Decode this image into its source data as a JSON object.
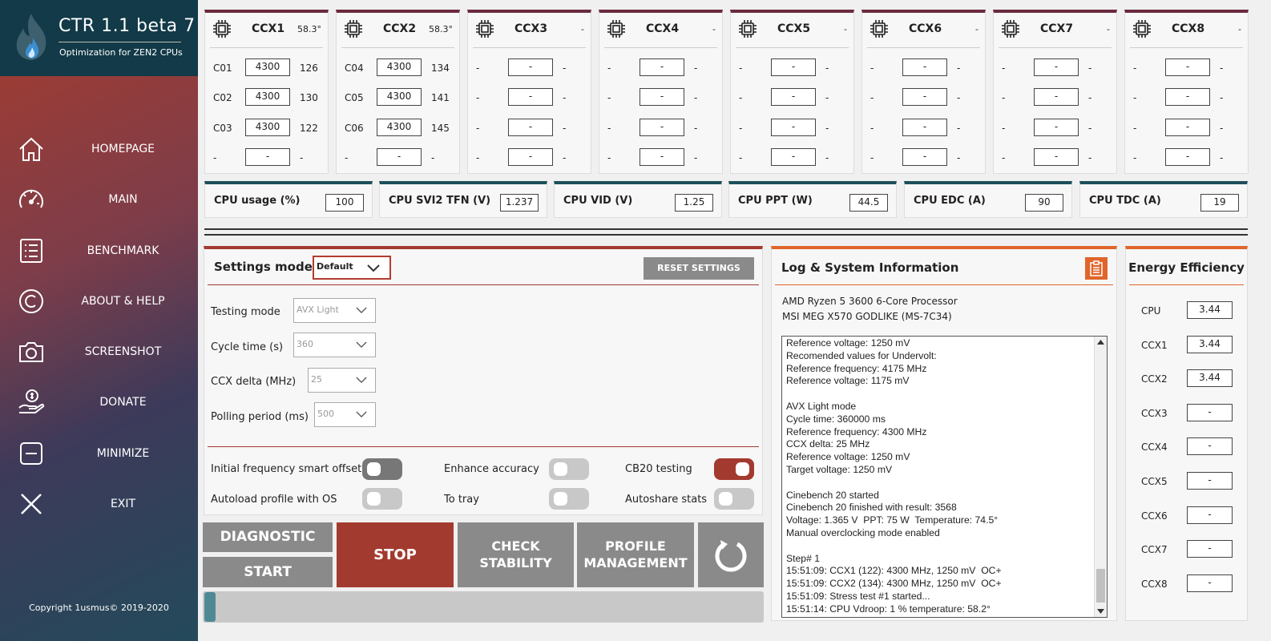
{
  "app": {
    "title": "CTR 1.1 beta 7",
    "subtitle": "Optimization for ZEN2 CPUs",
    "copyright": "Copyright 1usmus© 2019-2020"
  },
  "nav": [
    {
      "label": "HOMEPAGE",
      "icon": "home-icon"
    },
    {
      "label": "MAIN",
      "icon": "speedometer-icon"
    },
    {
      "label": "BENCHMARK",
      "icon": "list-icon"
    },
    {
      "label": "ABOUT & HELP",
      "icon": "copyright-icon"
    },
    {
      "label": "SCREENSHOT",
      "icon": "camera-icon"
    },
    {
      "label": "DONATE",
      "icon": "donate-hand-icon"
    },
    {
      "label": "MINIMIZE",
      "icon": "minimize-icon"
    },
    {
      "label": "EXIT",
      "icon": "close-icon"
    }
  ],
  "ccx": [
    {
      "name": "CCX1",
      "temp": "58.3°",
      "cores": [
        {
          "c": "C01",
          "f": "4300",
          "v": "126"
        },
        {
          "c": "C02",
          "f": "4300",
          "v": "130"
        },
        {
          "c": "C03",
          "f": "4300",
          "v": "122"
        },
        {
          "c": "-",
          "f": "-",
          "v": "-"
        }
      ]
    },
    {
      "name": "CCX2",
      "temp": "58.3°",
      "cores": [
        {
          "c": "C04",
          "f": "4300",
          "v": "134"
        },
        {
          "c": "C05",
          "f": "4300",
          "v": "141"
        },
        {
          "c": "C06",
          "f": "4300",
          "v": "145"
        },
        {
          "c": "-",
          "f": "-",
          "v": "-"
        }
      ]
    },
    {
      "name": "CCX3",
      "temp": "-",
      "cores": [
        {
          "c": "-",
          "f": "-",
          "v": "-"
        },
        {
          "c": "-",
          "f": "-",
          "v": "-"
        },
        {
          "c": "-",
          "f": "-",
          "v": "-"
        },
        {
          "c": "-",
          "f": "-",
          "v": "-"
        }
      ]
    },
    {
      "name": "CCX4",
      "temp": "-",
      "cores": [
        {
          "c": "-",
          "f": "-",
          "v": "-"
        },
        {
          "c": "-",
          "f": "-",
          "v": "-"
        },
        {
          "c": "-",
          "f": "-",
          "v": "-"
        },
        {
          "c": "-",
          "f": "-",
          "v": "-"
        }
      ]
    },
    {
      "name": "CCX5",
      "temp": "-",
      "cores": [
        {
          "c": "-",
          "f": "-",
          "v": "-"
        },
        {
          "c": "-",
          "f": "-",
          "v": "-"
        },
        {
          "c": "-",
          "f": "-",
          "v": "-"
        },
        {
          "c": "-",
          "f": "-",
          "v": "-"
        }
      ]
    },
    {
      "name": "CCX6",
      "temp": "-",
      "cores": [
        {
          "c": "-",
          "f": "-",
          "v": "-"
        },
        {
          "c": "-",
          "f": "-",
          "v": "-"
        },
        {
          "c": "-",
          "f": "-",
          "v": "-"
        },
        {
          "c": "-",
          "f": "-",
          "v": "-"
        }
      ]
    },
    {
      "name": "CCX7",
      "temp": "-",
      "cores": [
        {
          "c": "-",
          "f": "-",
          "v": "-"
        },
        {
          "c": "-",
          "f": "-",
          "v": "-"
        },
        {
          "c": "-",
          "f": "-",
          "v": "-"
        },
        {
          "c": "-",
          "f": "-",
          "v": "-"
        }
      ]
    },
    {
      "name": "CCX8",
      "temp": "-",
      "cores": [
        {
          "c": "-",
          "f": "-",
          "v": "-"
        },
        {
          "c": "-",
          "f": "-",
          "v": "-"
        },
        {
          "c": "-",
          "f": "-",
          "v": "-"
        },
        {
          "c": "-",
          "f": "-",
          "v": "-"
        }
      ]
    }
  ],
  "stats": [
    {
      "label": "CPU usage (%)",
      "value": "100"
    },
    {
      "label": "CPU SVI2 TFN (V)",
      "value": "1.237"
    },
    {
      "label": "CPU VID (V)",
      "value": "1.25"
    },
    {
      "label": "CPU PPT (W)",
      "value": "44.5"
    },
    {
      "label": "CPU EDC (A)",
      "value": "90"
    },
    {
      "label": "CPU TDC (A)",
      "value": "19"
    }
  ],
  "settings": {
    "title": "Settings mode",
    "mode": "Default",
    "reset": "RESET SETTINGS",
    "testing_mode_label": "Testing mode",
    "testing_mode": "AVX Light",
    "cycle_label": "Cycle time (s)",
    "cycle": "360",
    "ccx_delta_label": "CCX delta (MHz)",
    "ccx_delta": "25",
    "polling_label": "Polling period (ms)",
    "polling": "500",
    "toggles": {
      "initial_freq": "Initial frequency smart offset",
      "enhance": "Enhance accuracy",
      "cb20": "CB20 testing",
      "autoload": "Autoload profile with OS",
      "tray": "To tray",
      "autoshare": "Autoshare stats"
    }
  },
  "buttons": {
    "diagnostic": "DIAGNOSTIC",
    "start": "START",
    "stop": "STOP",
    "check1": "CHECK",
    "check2": "STABILITY",
    "profile1": "PROFILE",
    "profile2": "MANAGEMENT"
  },
  "progress": 0.01,
  "log": {
    "title": "Log & System Information",
    "cpu": "AMD Ryzen 5 3600 6-Core Processor",
    "board": "MSI MEG X570 GODLIKE (MS-7C34)",
    "text": "Reference voltage: 1250 mV\nRecomended values for Undervolt:\nReference frequency: 4175 MHz\nReference voltage: 1175 mV\n\nAVX Light mode\nCycle time: 360000 ms\nReference frequency: 4300 MHz\nCCX delta: 25 MHz\nReference voltage: 1250 mV\nTarget voltage: 1250 mV\n\nCinebench 20 started\nCinebench 20 finished with result: 3568\nVoltage: 1.365 V  PPT: 75 W  Temperature: 74.5°\nManual overclocking mode enabled\n\nStep# 1\n15:51:09: CCX1 (122): 4300 MHz, 1250 mV  OC+\n15:51:09: CCX2 (134): 4300 MHz, 1250 mV  OC+\n15:51:09: Stress test #1 started...\n15:51:14: CPU Vdroop: 1 % temperature: 58.2°"
  },
  "energy": {
    "title": "Energy Efficiency",
    "rows": [
      {
        "n": "CPU",
        "v": "3.44"
      },
      {
        "n": "CCX1",
        "v": "3.44"
      },
      {
        "n": "CCX2",
        "v": "3.44"
      },
      {
        "n": "CCX3",
        "v": "-"
      },
      {
        "n": "CCX4",
        "v": "-"
      },
      {
        "n": "CCX5",
        "v": "-"
      },
      {
        "n": "CCX6",
        "v": "-"
      },
      {
        "n": "CCX7",
        "v": "-"
      },
      {
        "n": "CCX8",
        "v": "-"
      }
    ]
  }
}
